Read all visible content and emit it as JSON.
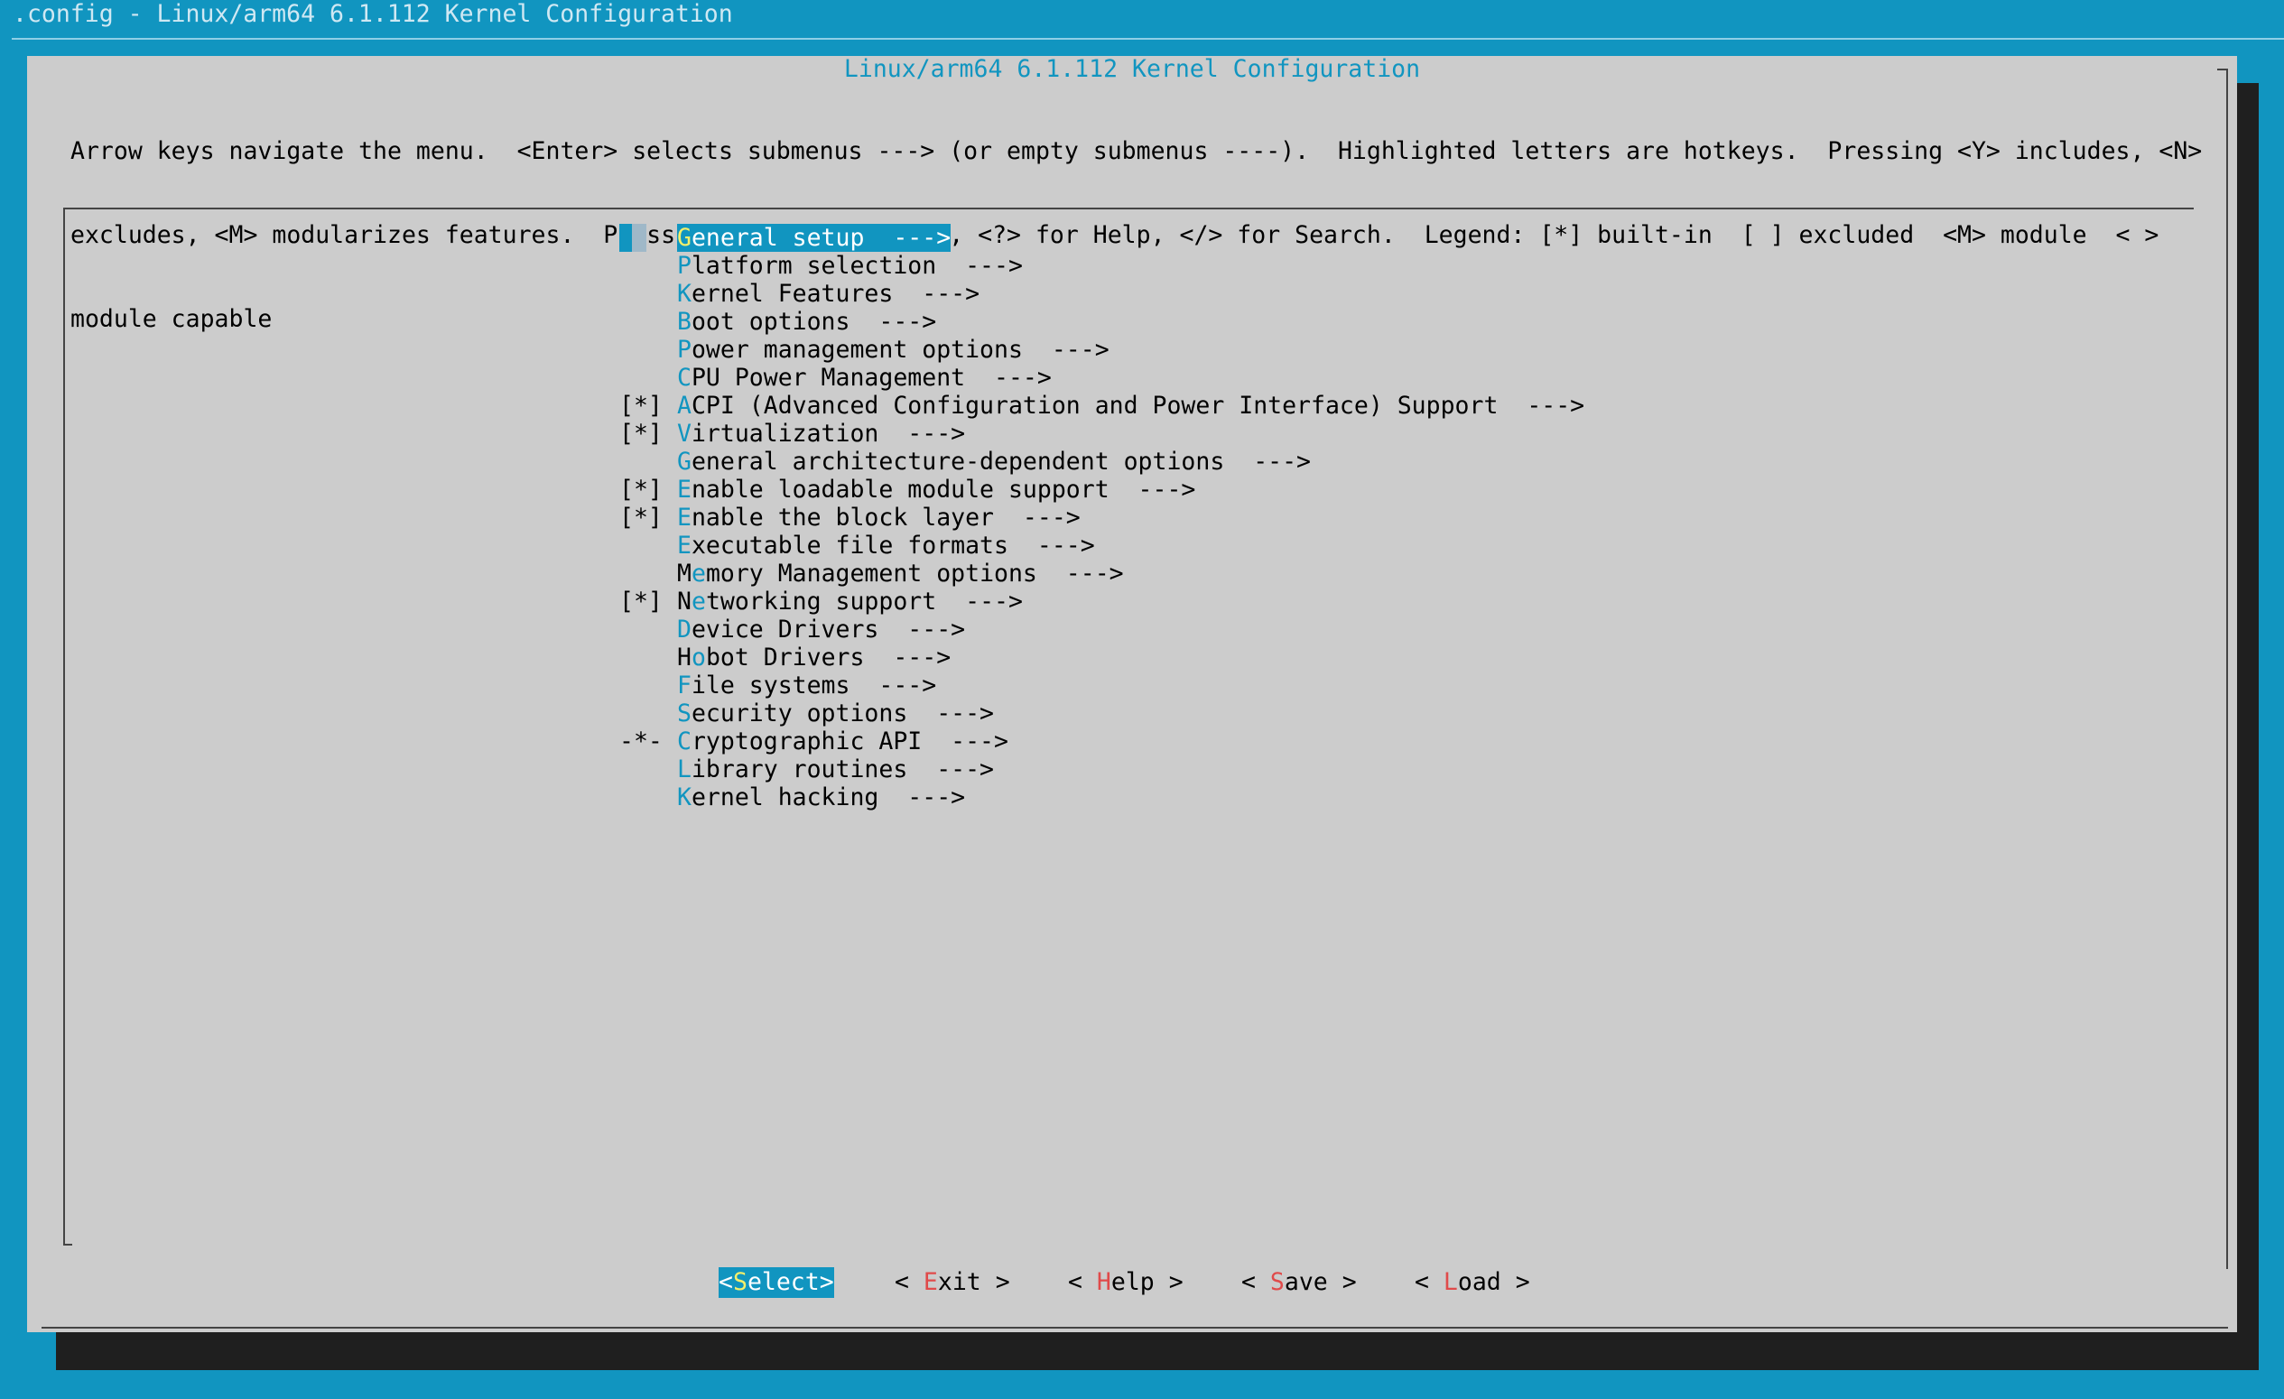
{
  "window": {
    "backtitle": ".config - Linux/arm64 6.1.112 Kernel Configuration"
  },
  "dialog": {
    "title": "Linux/arm64 6.1.112 Kernel Configuration",
    "help_lines": [
      "Arrow keys navigate the menu.  <Enter> selects submenus ---> (or empty submenus ----).  Highlighted letters are hotkeys.  Pressing <Y> includes, <N>",
      "excludes, <M> modularizes features.  Press <Esc><Esc> to exit, <?> for Help, </> for Search.  Legend: [*] built-in  [ ] excluded  <M> module  < >",
      "module capable"
    ]
  },
  "menu": {
    "selected_index": 0,
    "items": [
      {
        "prefix": "",
        "hotkey": "G",
        "rest": "eneral setup  --->"
      },
      {
        "prefix": "",
        "hotkey": "P",
        "rest": "latform selection  --->"
      },
      {
        "prefix": "",
        "hotkey": "K",
        "rest": "ernel Features  --->"
      },
      {
        "prefix": "",
        "hotkey": "B",
        "rest": "oot options  --->"
      },
      {
        "prefix": "",
        "hotkey": "P",
        "rest": "ower management options  --->"
      },
      {
        "prefix": "",
        "hotkey": "C",
        "rest": "PU Power Management  --->"
      },
      {
        "prefix": "[*]",
        "hotkey": "A",
        "rest": "CPI (Advanced Configuration and Power Interface) Support  --->"
      },
      {
        "prefix": "[*]",
        "hotkey": "V",
        "rest": "irtualization  --->"
      },
      {
        "prefix": "",
        "hotkey": "G",
        "rest": "eneral architecture-dependent options  --->"
      },
      {
        "prefix": "[*]",
        "hotkey": "E",
        "rest": "nable loadable module support  --->"
      },
      {
        "prefix": "[*]",
        "hotkey": "E",
        "rest": "nable the block layer  --->"
      },
      {
        "prefix": "",
        "hotkey": "E",
        "rest": "xecutable file formats  --->"
      },
      {
        "prefix": "",
        "pre": "M",
        "hotkey": "e",
        "rest": "mory Management options  --->"
      },
      {
        "prefix": "[*]",
        "pre": "N",
        "hotkey": "e",
        "rest": "tworking support  --->"
      },
      {
        "prefix": "",
        "hotkey": "D",
        "rest": "evice Drivers  --->"
      },
      {
        "prefix": "",
        "pre": "H",
        "hotkey": "o",
        "rest": "bot Drivers  --->"
      },
      {
        "prefix": "",
        "hotkey": "F",
        "rest": "ile systems  --->"
      },
      {
        "prefix": "",
        "hotkey": "S",
        "rest": "ecurity options  --->"
      },
      {
        "prefix": "-*-",
        "hotkey": "C",
        "rest": "ryptographic API  --->"
      },
      {
        "prefix": "",
        "hotkey": "L",
        "rest": "ibrary routines  --->"
      },
      {
        "prefix": "",
        "hotkey": "K",
        "rest": "ernel hacking  --->"
      }
    ]
  },
  "buttons": [
    {
      "left": "<",
      "key": "S",
      "rest": "elect",
      "right": ">",
      "active": true,
      "name": "select-button"
    },
    {
      "left": "< ",
      "key": "E",
      "rest": "xit",
      "right": " >",
      "active": false,
      "name": "exit-button"
    },
    {
      "left": "< ",
      "key": "H",
      "rest": "elp",
      "right": " >",
      "active": false,
      "name": "help-button"
    },
    {
      "left": "< ",
      "key": "S",
      "rest": "ave",
      "right": " >",
      "active": false,
      "name": "save-button"
    },
    {
      "left": "< ",
      "key": "L",
      "rest": "oad",
      "right": " >",
      "active": false,
      "name": "load-button"
    }
  ],
  "colors": {
    "background": "#1195c0",
    "dialog": "#cccccc",
    "hotkey": "#1195c0",
    "selected_hotkey": "#f5ef6a",
    "button_key": "#e04a4a"
  }
}
